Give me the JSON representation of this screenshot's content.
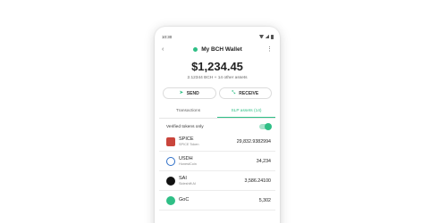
{
  "statusbar": {
    "time": "10:30"
  },
  "appbar": {
    "back_icon": "chevron-left-icon",
    "title": "My BCH Wallet",
    "menu_icon": "more-vertical-icon"
  },
  "balance": {
    "amount": "$1,234.45",
    "subtitle": "2.12344 BCH + 14 other assets"
  },
  "actions": {
    "send_label": "SEND",
    "receive_label": "RECEIVE"
  },
  "tabs": [
    {
      "label": "Transactions",
      "active": false
    },
    {
      "label": "SLP assets (14)",
      "active": true
    }
  ],
  "filter": {
    "label": "Verified tokens only",
    "enabled": true
  },
  "tokens": [
    {
      "symbol": "SPICE",
      "name": "SPICE Token",
      "amount": "29,832.9382994"
    },
    {
      "symbol": "USDH",
      "name": "HonestCoin",
      "amount": "34,234"
    },
    {
      "symbol": "SAI",
      "name": "Sideshift AI",
      "amount": "3,586.24100"
    },
    {
      "symbol": "GoC",
      "name": "",
      "amount": "5,302"
    }
  ],
  "colors": {
    "accent": "#2fbf86"
  }
}
